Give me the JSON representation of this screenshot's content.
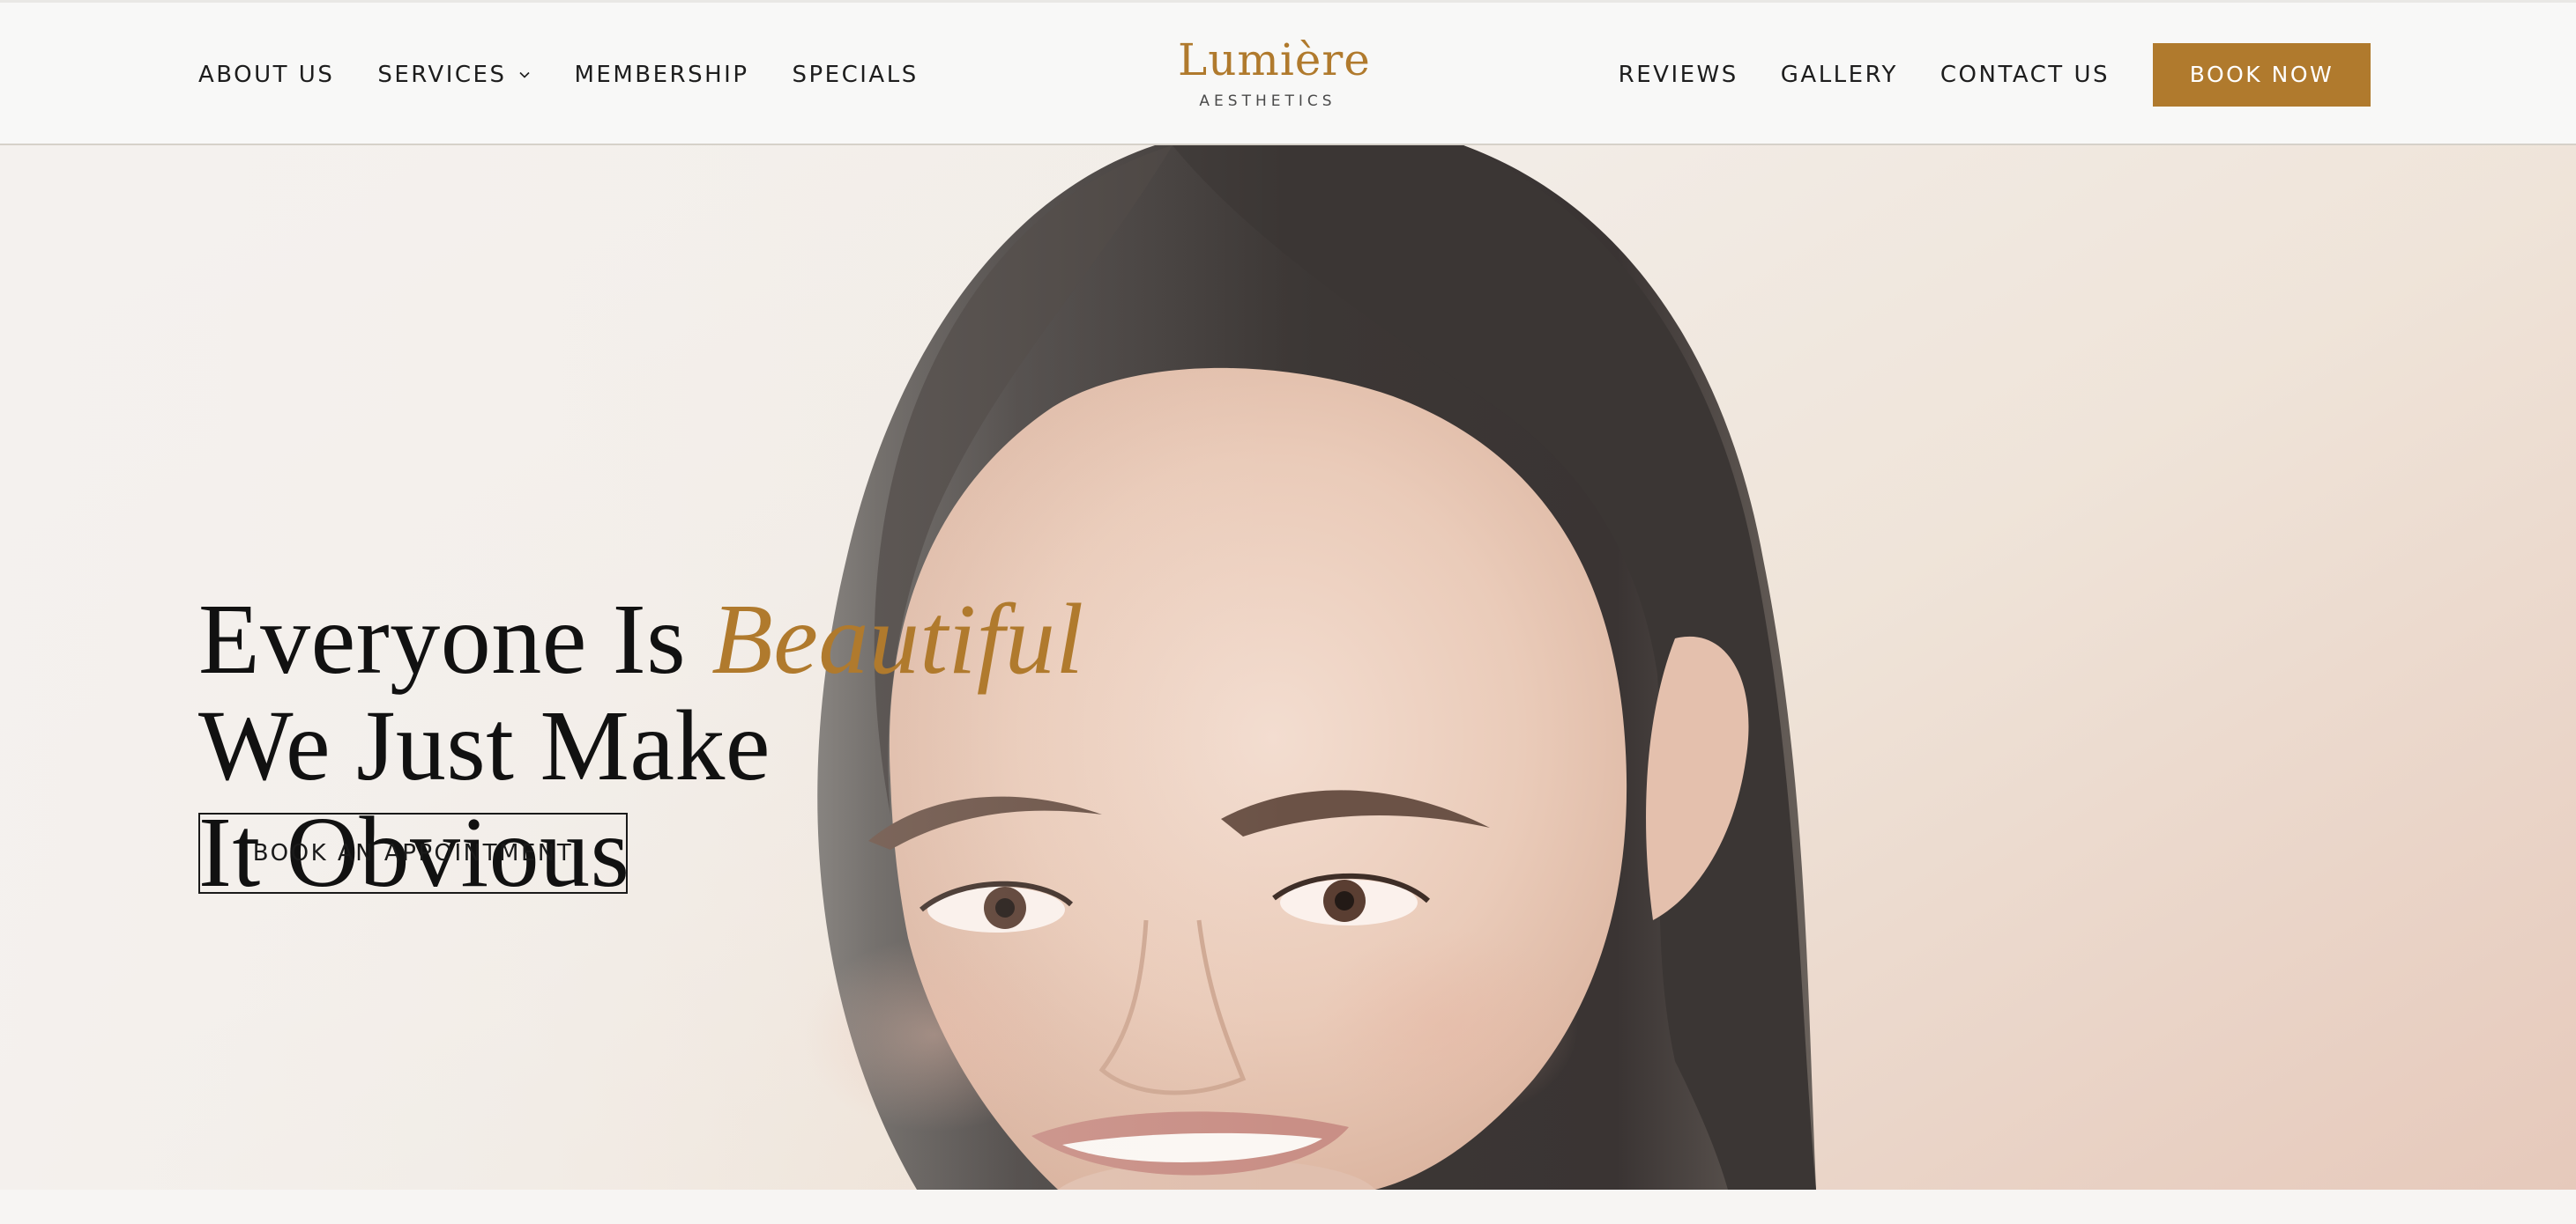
{
  "header": {
    "nav_left": [
      {
        "label": "ABOUT US"
      },
      {
        "label": "SERVICES",
        "has_dropdown": true
      },
      {
        "label": "MEMBERSHIP"
      },
      {
        "label": "SPECIALS"
      }
    ],
    "logo": {
      "name": "Lumière",
      "tagline": "AESTHETICS"
    },
    "nav_right": [
      {
        "label": "REVIEWS"
      },
      {
        "label": "GALLERY"
      },
      {
        "label": "CONTACT US"
      }
    ],
    "book_now_label": "BOOK NOW"
  },
  "hero": {
    "headline": {
      "line1_prefix": "Everyone Is ",
      "line1_accent": "Beautiful",
      "line2": "We Just Make",
      "line3": "It Obvious"
    },
    "cta_label": "BOOK AN APPOINTMENT"
  },
  "icons": {
    "services_dropdown": "chevron-down-icon"
  },
  "colors": {
    "brand_gold": "#b07a2d",
    "text_dark": "#111111",
    "header_bg": "#f8f8f7"
  }
}
